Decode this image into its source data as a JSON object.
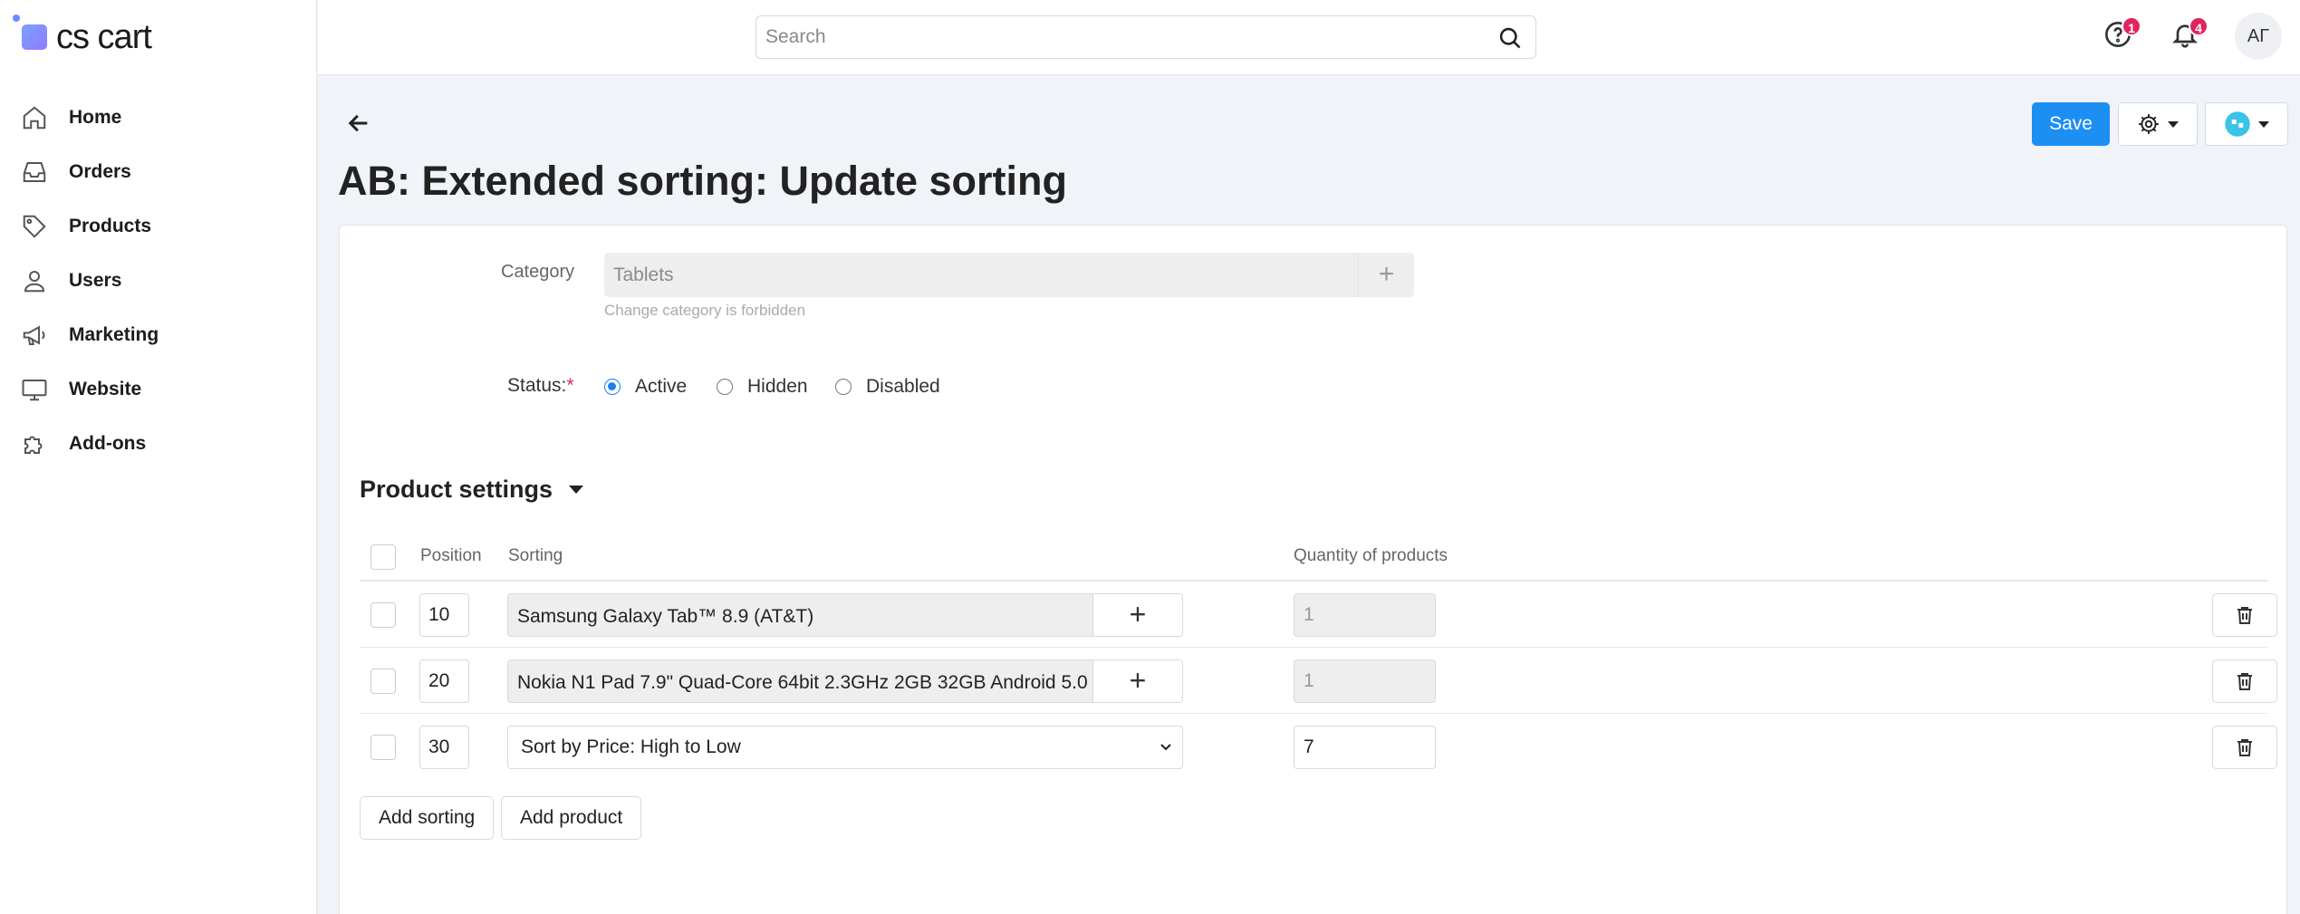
{
  "brand": {
    "logo_text": "cs cart"
  },
  "sidebar": {
    "items": [
      {
        "label": "Home",
        "icon": "home-icon"
      },
      {
        "label": "Orders",
        "icon": "inbox-icon"
      },
      {
        "label": "Products",
        "icon": "tag-icon"
      },
      {
        "label": "Users",
        "icon": "user-icon"
      },
      {
        "label": "Marketing",
        "icon": "megaphone-icon"
      },
      {
        "label": "Website",
        "icon": "monitor-icon"
      },
      {
        "label": "Add-ons",
        "icon": "puzzle-icon"
      }
    ]
  },
  "topbar": {
    "search_placeholder": "Search",
    "help_badge": "1",
    "notifications_badge": "4",
    "avatar_initials": "АГ"
  },
  "header": {
    "title": "AB: Extended sorting: Update sorting",
    "save_label": "Save"
  },
  "form": {
    "category_label": "Category",
    "category_value": "Tablets",
    "category_hint": "Change category is forbidden",
    "status_label": "Status:",
    "status_required_mark": "*",
    "status_options": [
      "Active",
      "Hidden",
      "Disabled"
    ],
    "status_selected": "Active"
  },
  "product_settings": {
    "title": "Product settings",
    "columns": {
      "position": "Position",
      "sorting": "Sorting",
      "quantity": "Quantity of products"
    },
    "rows": [
      {
        "position": "10",
        "sorting": "Samsung Galaxy Tab™ 8.9 (AT&T)",
        "quantity": "1",
        "type": "product"
      },
      {
        "position": "20",
        "sorting": "Nokia N1 Pad 7.9\" Quad-Core 64bit 2.3GHz 2GB 32GB Android 5.0",
        "quantity": "1",
        "type": "product"
      },
      {
        "position": "30",
        "sorting": "Sort by Price: High to Low",
        "quantity": "7",
        "type": "sorting"
      }
    ],
    "add_sorting_label": "Add sorting",
    "add_product_label": "Add product"
  },
  "colors": {
    "accent": "#1d8ff2",
    "badge": "#e0245e",
    "radio": "#1d7ef2"
  }
}
